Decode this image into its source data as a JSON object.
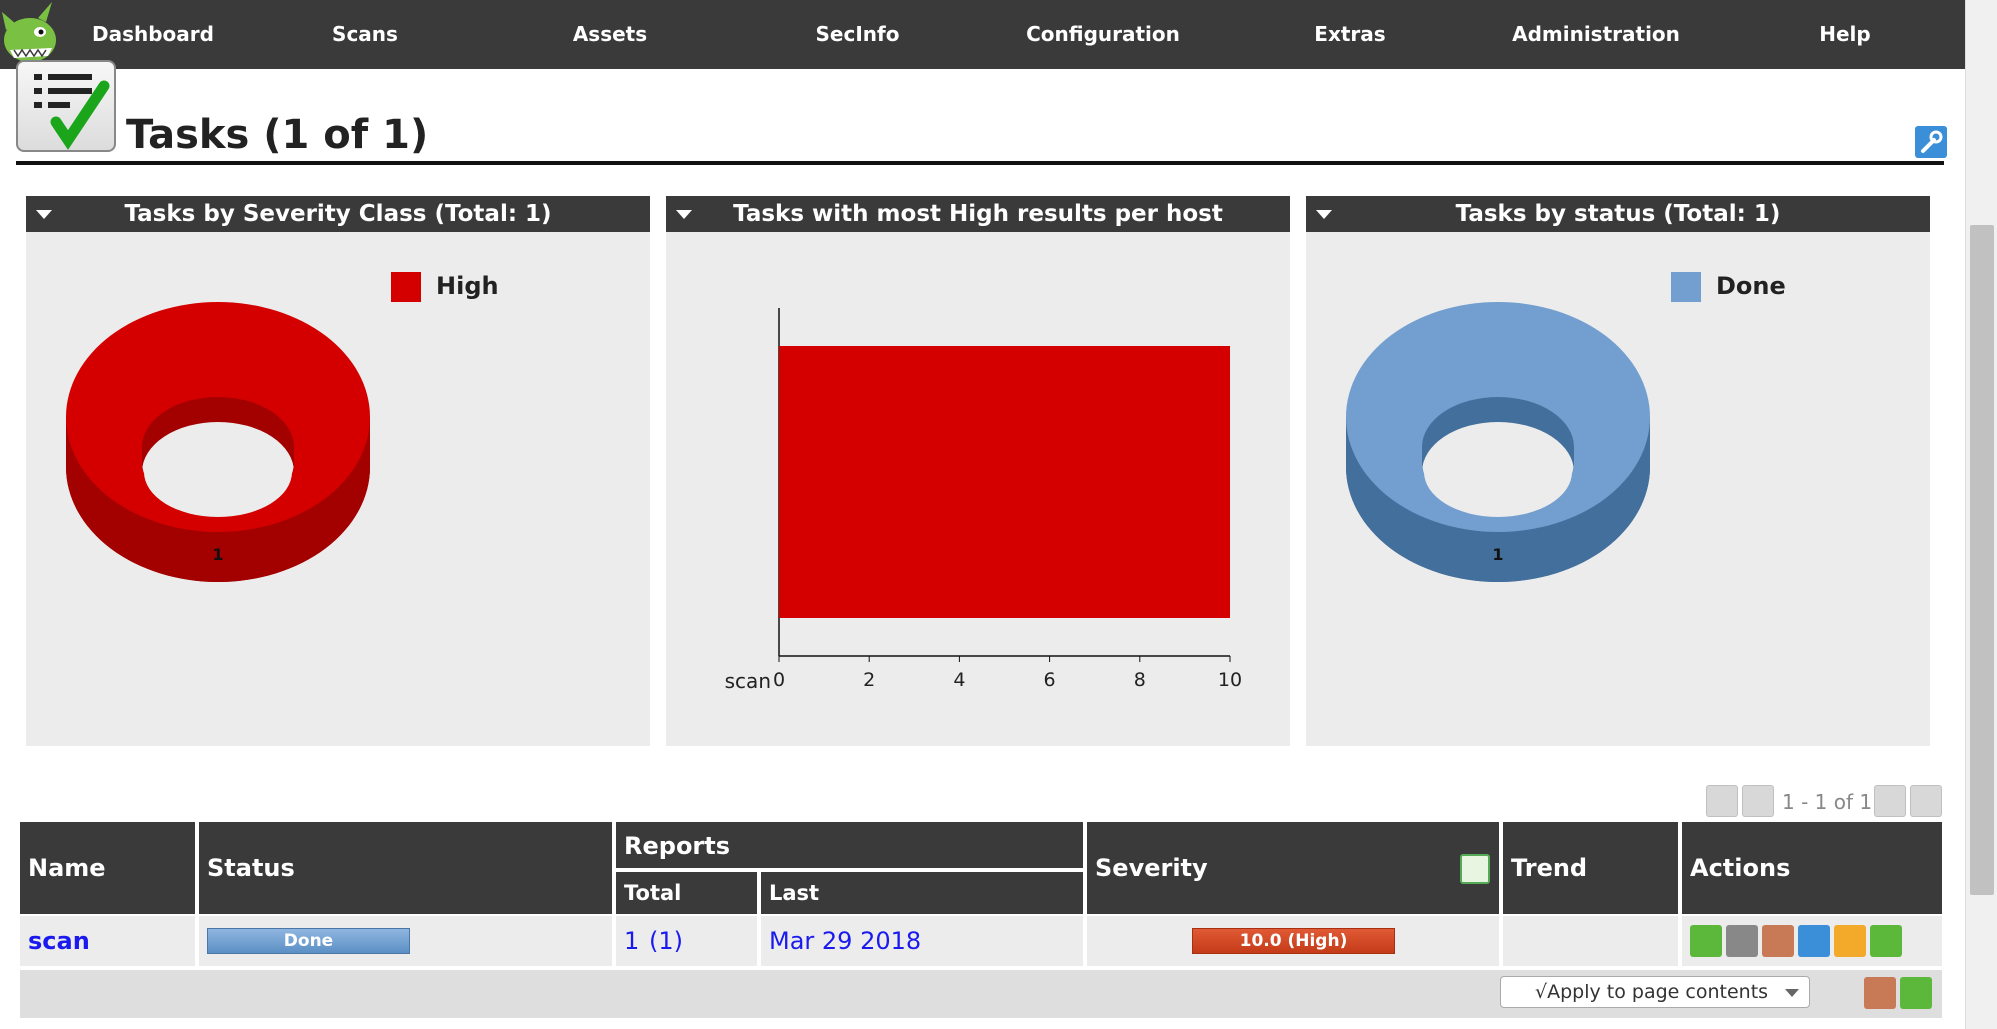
{
  "nav": {
    "items": [
      "Dashboard",
      "Scans",
      "Assets",
      "SecInfo",
      "Configuration",
      "Extras",
      "Administration",
      "Help"
    ]
  },
  "page": {
    "title": "Tasks (1 of 1)"
  },
  "panels": [
    {
      "title": "Tasks by Severity Class (Total: 1)",
      "legend": "High",
      "slice_label": "1",
      "color": "#d40000"
    },
    {
      "title": "Tasks with most High results per host",
      "category": "scan"
    },
    {
      "title": "Tasks by status (Total: 1)",
      "legend": "Done",
      "slice_label": "1",
      "color": "#729fcf"
    }
  ],
  "chart_data": [
    {
      "type": "pie",
      "categories": [
        "High"
      ],
      "values": [
        1
      ],
      "title": "Tasks by Severity Class (Total: 1)",
      "colors": [
        "#d40000"
      ]
    },
    {
      "type": "bar",
      "orientation": "horizontal",
      "categories": [
        "scan"
      ],
      "values": [
        10
      ],
      "xlim": [
        0,
        10
      ],
      "xticks": [
        "0",
        "2",
        "4",
        "6",
        "8",
        "10"
      ],
      "title": "Tasks with most High results per host",
      "colors": [
        "#d40000"
      ]
    },
    {
      "type": "pie",
      "categories": [
        "Done"
      ],
      "values": [
        1
      ],
      "title": "Tasks by status (Total: 1)",
      "colors": [
        "#729fcf"
      ]
    }
  ],
  "pager": {
    "text": "1 - 1 of 1"
  },
  "table": {
    "headers": {
      "name": "Name",
      "status": "Status",
      "reports": "Reports",
      "total": "Total",
      "last": "Last",
      "severity": "Severity",
      "trend": "Trend",
      "actions": "Actions"
    },
    "rows": [
      {
        "name": "scan",
        "status": "Done",
        "total_count": "1",
        "total_paren": "(1)",
        "last": "Mar 29 2018",
        "severity": "10.0 (High)",
        "trend": ""
      }
    ]
  },
  "footer": {
    "apply_label": "√Apply to page contents"
  },
  "colors": {
    "nav_bg": "#3a3a3a",
    "high": "#d40000",
    "done": "#729fcf",
    "link": "#1a1aef"
  }
}
